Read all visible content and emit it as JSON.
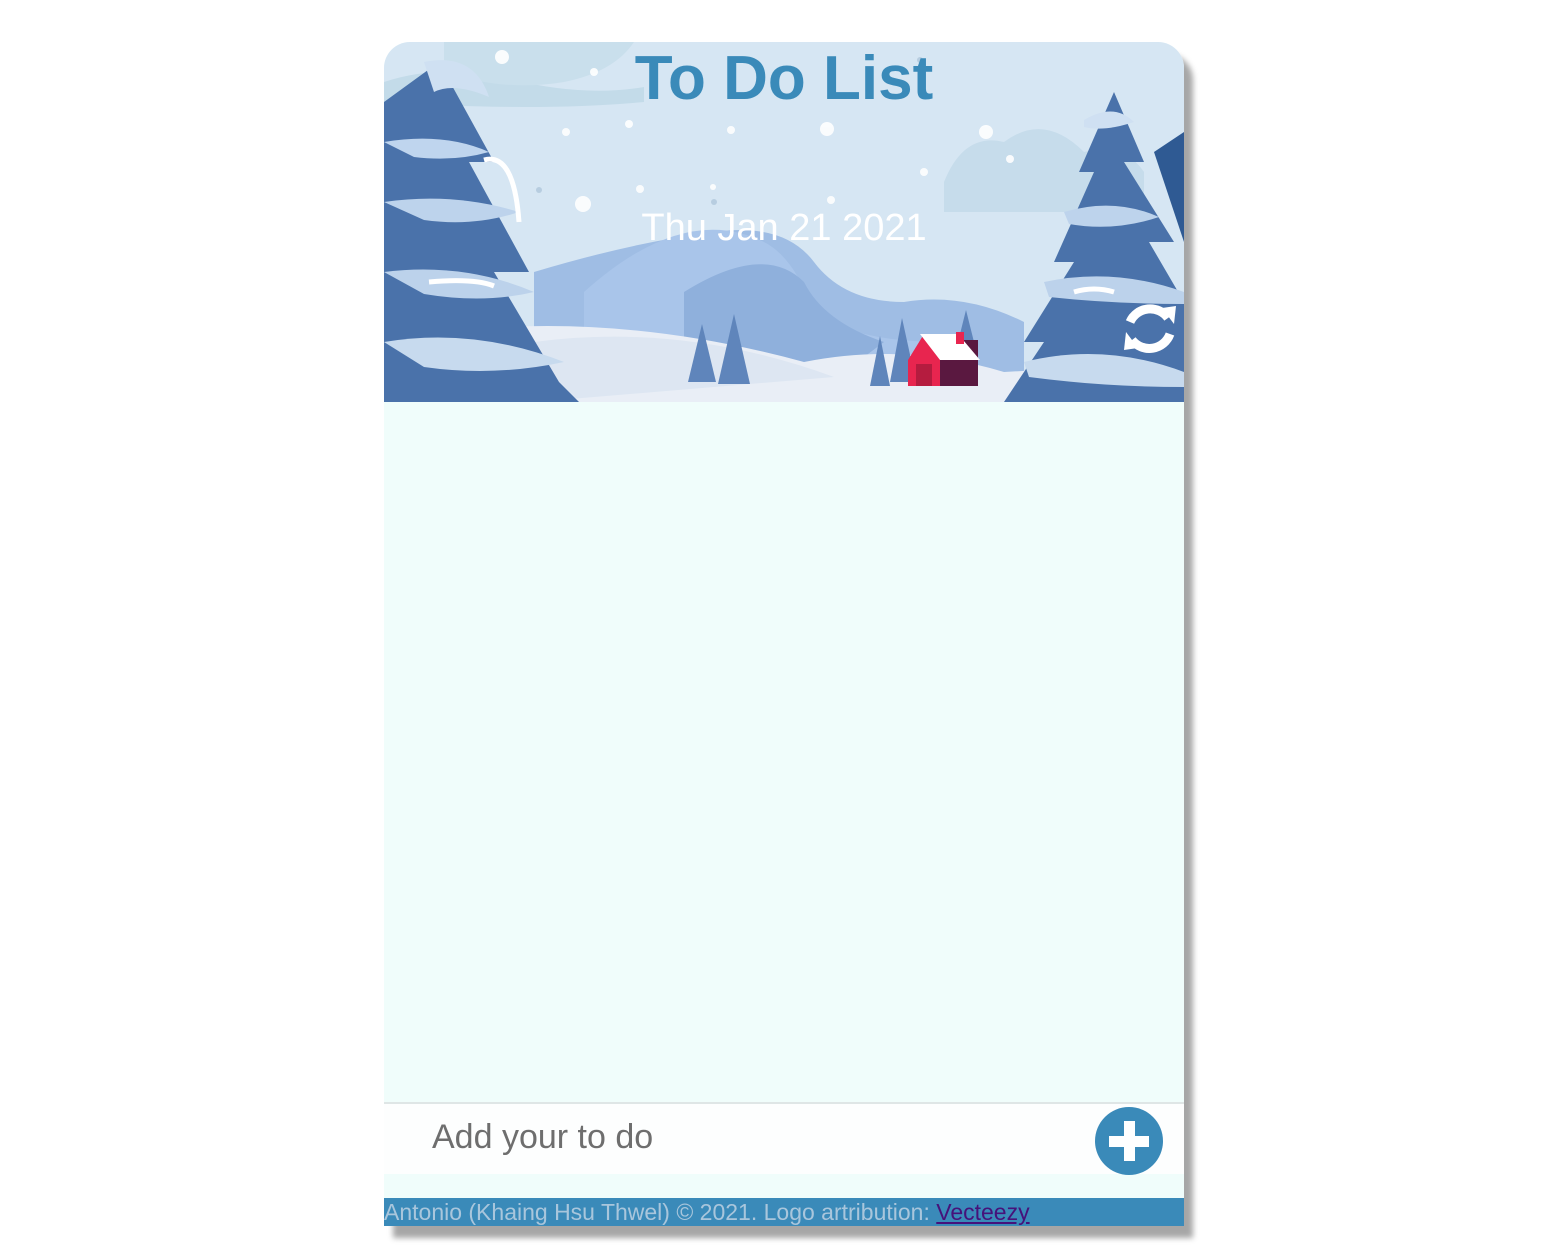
{
  "header": {
    "title": "To Do List",
    "date": "Thu Jan 21 2021",
    "refresh_icon": "refresh-icon"
  },
  "todo": {
    "items": []
  },
  "add": {
    "placeholder": "Add your to do",
    "value": "",
    "button_icon": "plus-circle-icon"
  },
  "footer": {
    "text": "Antonio (Khaing Hsu Thwel) © 2021. Logo artribution: ",
    "link_label": "Vecteezy"
  },
  "colors": {
    "accent": "#3a8ab9",
    "list_background": "#f0fdfb",
    "date_text": "#ffffff",
    "footer_link": "#46127a"
  }
}
